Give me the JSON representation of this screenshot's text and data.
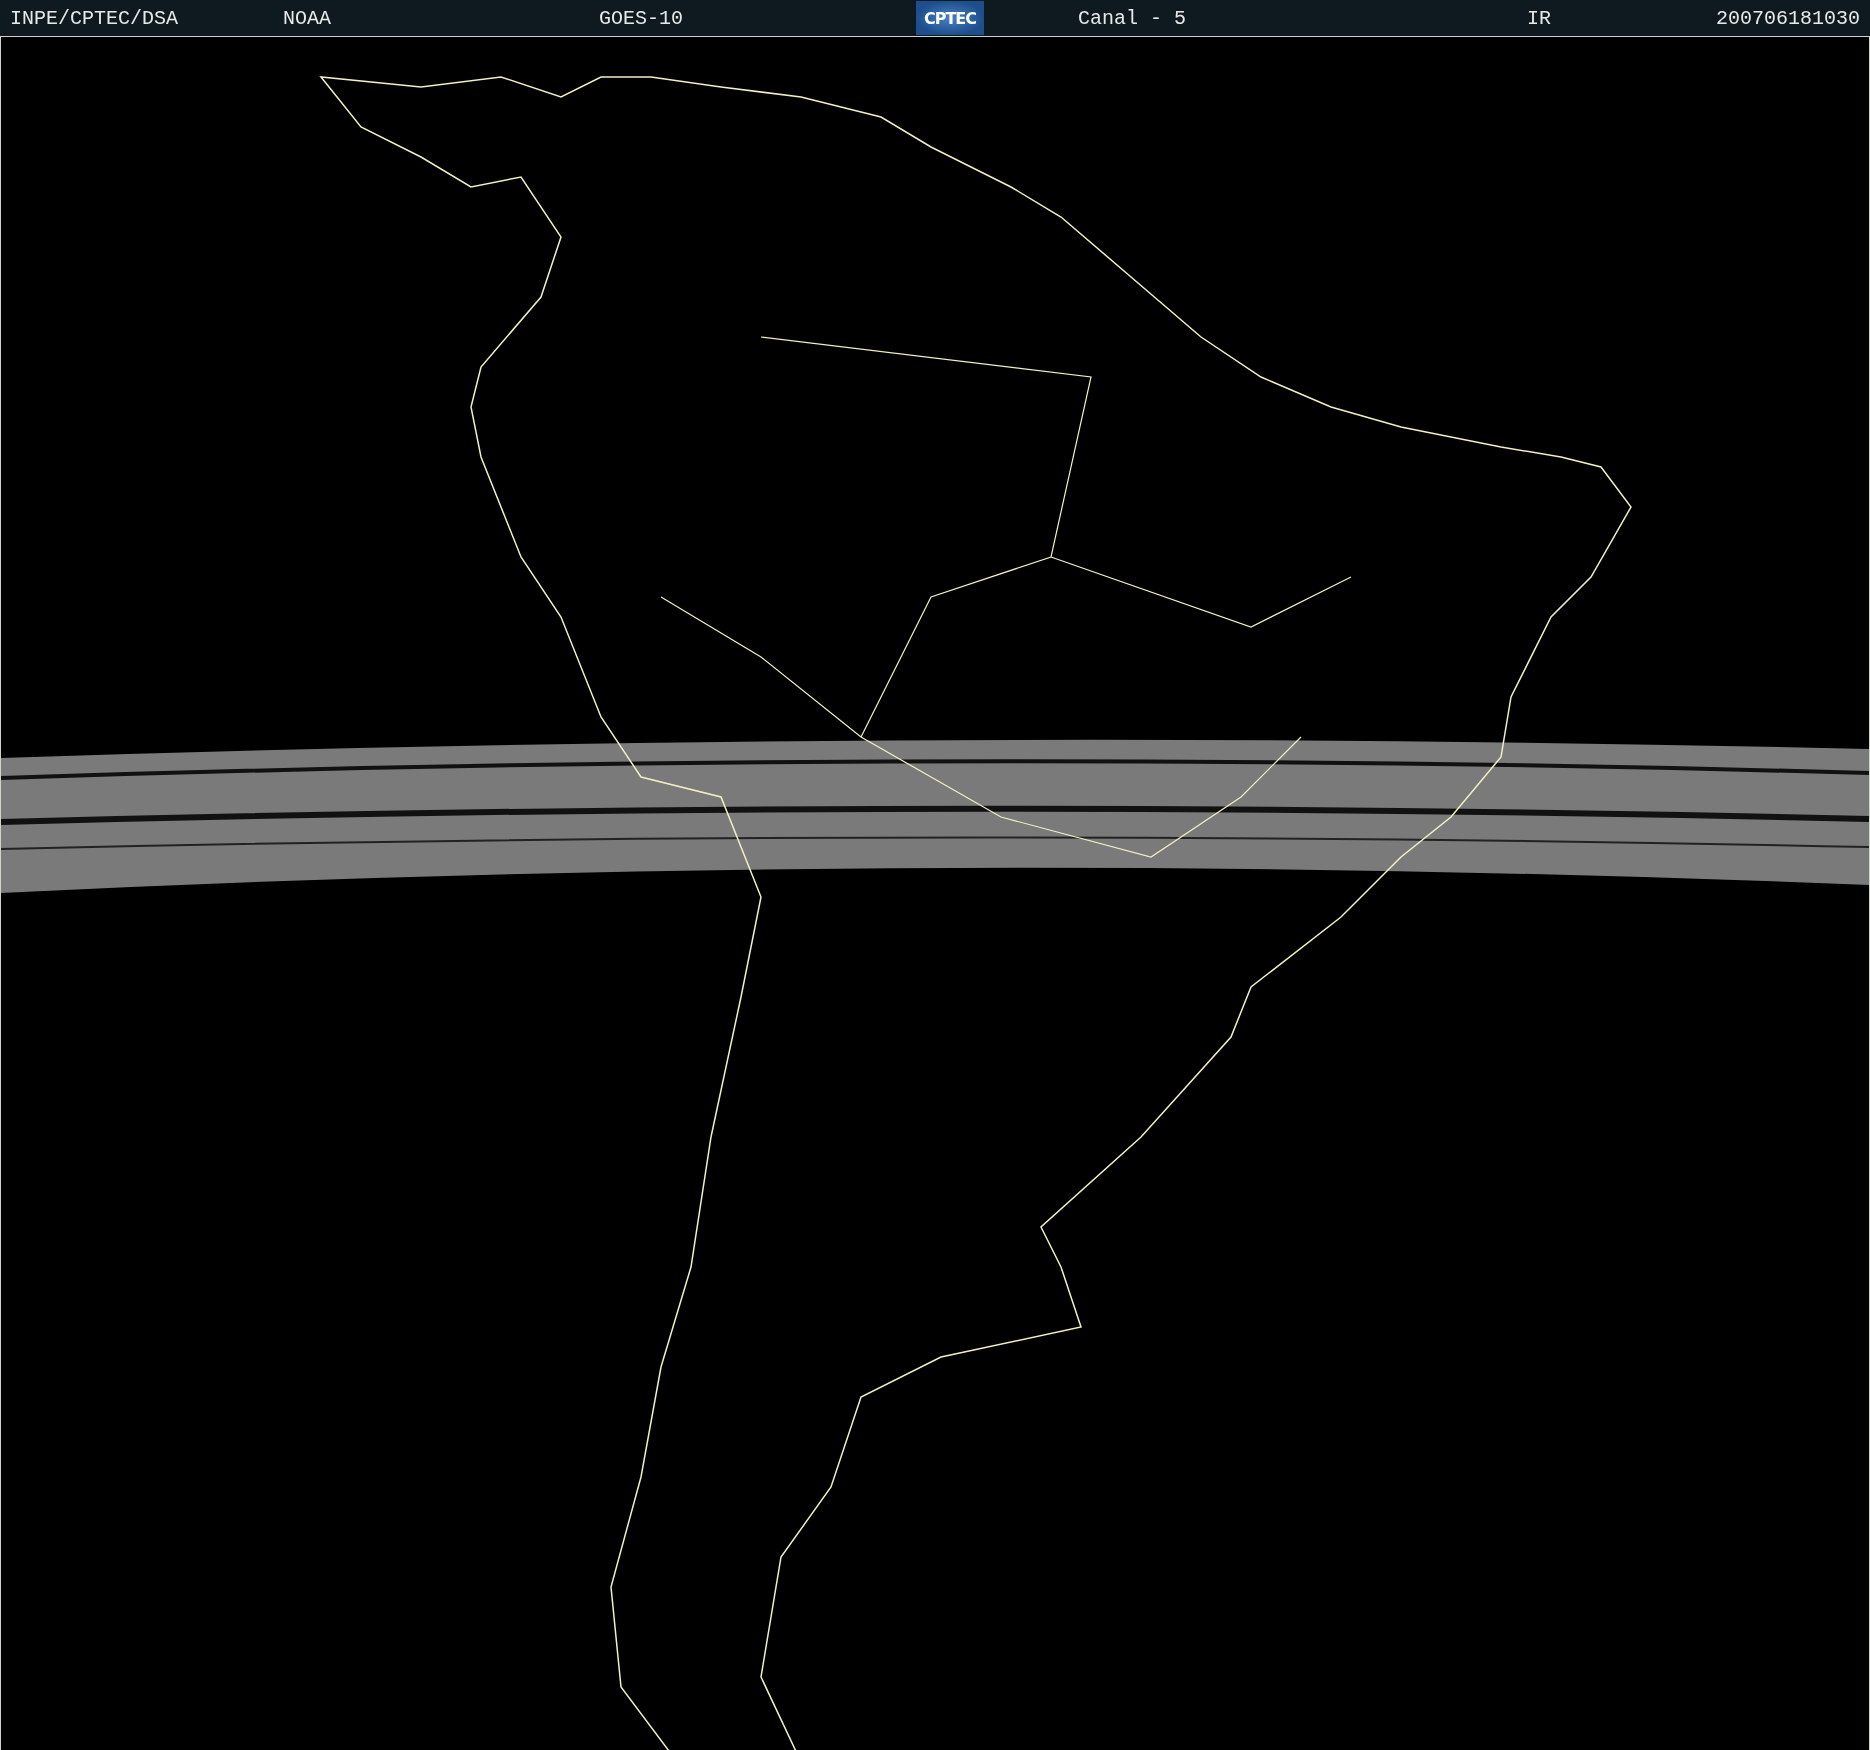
{
  "header": {
    "items": [
      {
        "kind": "text",
        "text": "INPE/CPTEC/DSA"
      },
      {
        "kind": "text",
        "text": "NOAA"
      },
      {
        "kind": "text",
        "text": "GOES-10"
      },
      {
        "kind": "logo",
        "text": "CPTEC"
      },
      {
        "kind": "text",
        "text": "Canal - 5"
      },
      {
        "kind": "text",
        "text": "IR"
      },
      {
        "kind": "date",
        "text": "200706181030"
      }
    ]
  }
}
